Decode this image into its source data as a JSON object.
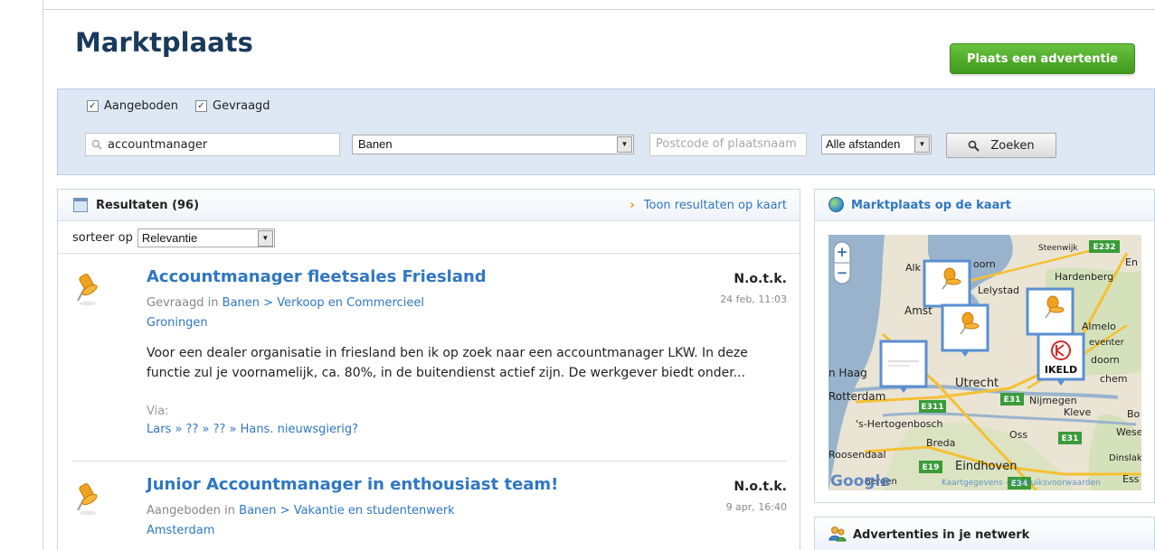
{
  "header": {
    "logo": "Marktplaats",
    "post_button": "Plaats een advertentie"
  },
  "search": {
    "checkbox_offered": "Aangeboden",
    "checkbox_offered_checked": true,
    "checkbox_wanted": "Gevraagd",
    "checkbox_wanted_checked": true,
    "query": "accountmanager",
    "category": "Banen",
    "postcode_placeholder": "Postcode of plaatsnaam",
    "distance": "Alle afstanden",
    "button_label": "Zoeken"
  },
  "results": {
    "title": "Resultaten (96)",
    "map_link": "Toon resultaten op kaart",
    "sort_label": "sorteer op",
    "sort_value": "Relevantie",
    "listings": [
      {
        "title": "Accountmanager fleetsales Friesland",
        "price": "N.o.t.k.",
        "date": "24 feb, 11:03",
        "type": "Gevraagd in",
        "category": "Banen > Verkoop en Commercieel",
        "location": "Groningen",
        "description": "Voor een dealer organisatie in friesland ben ik op zoek naar een accountmanager LKW. In deze functie zul je voornamelijk, ca. 80%, in de buitendienst actief zijn. De werkgever biedt onder...",
        "via_label": "Via:",
        "via_path": "Lars » ?? » ?? » Hans. nieuwsgierig?"
      },
      {
        "title": "Junior Accountmanager in enthousiast team!",
        "price": "N.o.t.k.",
        "date": "9 apr, 16:40",
        "type": "Aangeboden in",
        "category": "Banen > Vakantie en studentenwerk",
        "location": "Amsterdam"
      }
    ]
  },
  "map_panel": {
    "title": "Marktplaats op de kaart",
    "zoom_in": "+",
    "zoom_out": "−",
    "labels": {
      "alk": "Alk",
      "oorn": "oorn",
      "steenwijk": "Steenwijk",
      "e232": "E232",
      "en": "En",
      "hardenberg": "Hardenberg",
      "lelystad": "Lelystad",
      "amst": "Amst",
      "almelo": "Almelo",
      "eventer": "eventer",
      "doorn": "doorn",
      "chem": "chem",
      "haag": "n Haag",
      "utrecht": "Utrecht",
      "rotterdam": "Rotterdam",
      "e31": "E31",
      "nijmegen": "Nijmegen",
      "e311": "E311",
      "kleve": "Kleve",
      "bo": "Bo",
      "hertogenbosch": "'s-Hertogenbosch",
      "oss": "Oss",
      "wesel": "Wesel",
      "breda": "Breda",
      "e31b": "E31",
      "roosendaal": "Roosendaal",
      "dinslaken": "Dinslaken",
      "eindhoven": "Eindhoven",
      "e19": "E19",
      "e34": "E34",
      "bergen": "Bergen",
      "essen": "Ess",
      "ikeld": "IKELD",
      "google": "Google",
      "footer": "Kaartgegevens - Gebruiksvoorwaarden"
    }
  },
  "network_panel": {
    "title": "Advertenties in je netwerk"
  },
  "colors": {
    "brand_blue": "#1a3a5c",
    "link_blue": "#2f77c2",
    "post_green": "#4caf2a",
    "arrow_orange": "#f08b12"
  },
  "icons": {
    "search": "magnifier-icon",
    "results": "table-icon",
    "map": "globe-icon",
    "listing": "pushpin-icon",
    "network": "people-icon"
  }
}
